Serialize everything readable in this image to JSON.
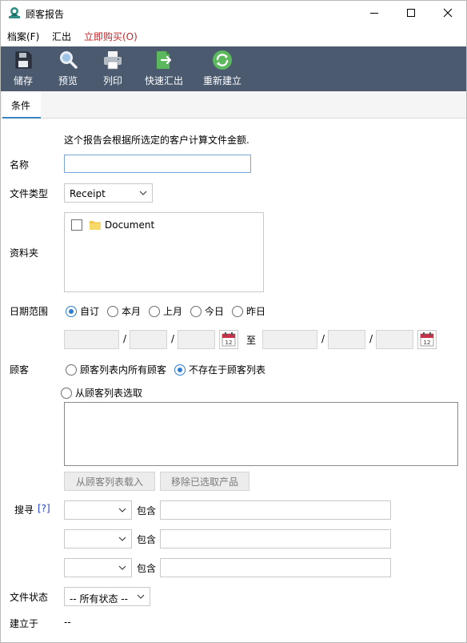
{
  "window": {
    "title": "顾客报告",
    "minimize_glyph": "—",
    "maximize_glyph": "☐",
    "close_glyph": "✕"
  },
  "menu": {
    "file": "档案(F)",
    "export": "汇出",
    "buy": "立即购买(O)",
    "buy_color": "#c0282d"
  },
  "toolbar": {
    "bg_color": "#4b5a6e",
    "items": [
      {
        "label": "储存",
        "icon": "floppy-disk-icon"
      },
      {
        "label": "预览",
        "icon": "magnifier-icon"
      },
      {
        "label": "列印",
        "icon": "printer-icon"
      },
      {
        "label": "快速汇出",
        "icon": "export-document-icon"
      },
      {
        "label": "重新建立",
        "icon": "refresh-icon"
      }
    ]
  },
  "tabs": [
    {
      "label": "条件",
      "active": true
    }
  ],
  "form": {
    "description": "这个报告会根据所选定的客户计算文件金额.",
    "name_label": "名称",
    "name_value": "",
    "doc_type_label": "文件类型",
    "doc_type_value": "Receipt",
    "folder_label": "资料夹",
    "folder_item": "Document",
    "date_range_label": "日期范围",
    "date_options": [
      {
        "label": "自订",
        "selected": true
      },
      {
        "label": "本月",
        "selected": false
      },
      {
        "label": "上月",
        "selected": false
      },
      {
        "label": "今日",
        "selected": false
      },
      {
        "label": "昨日",
        "selected": false
      }
    ],
    "date_separator": "/",
    "date_to": "至",
    "calendar_day": "12",
    "customer_label": "顾客",
    "customer_options": [
      {
        "label": "顾客列表内所有顾客",
        "selected": false
      },
      {
        "label": "不存在于顾客列表",
        "selected": true
      },
      {
        "label": "从顾客列表选取",
        "selected": false
      }
    ],
    "load_button": "从顾客列表载入",
    "remove_button": "移除已选取产品",
    "search_label": "搜寻",
    "search_help": "[?]",
    "contains_label": "包含",
    "status_label": "文件状态",
    "status_value": "-- 所有状态 --",
    "created_label": "建立于",
    "created_value": "--"
  }
}
